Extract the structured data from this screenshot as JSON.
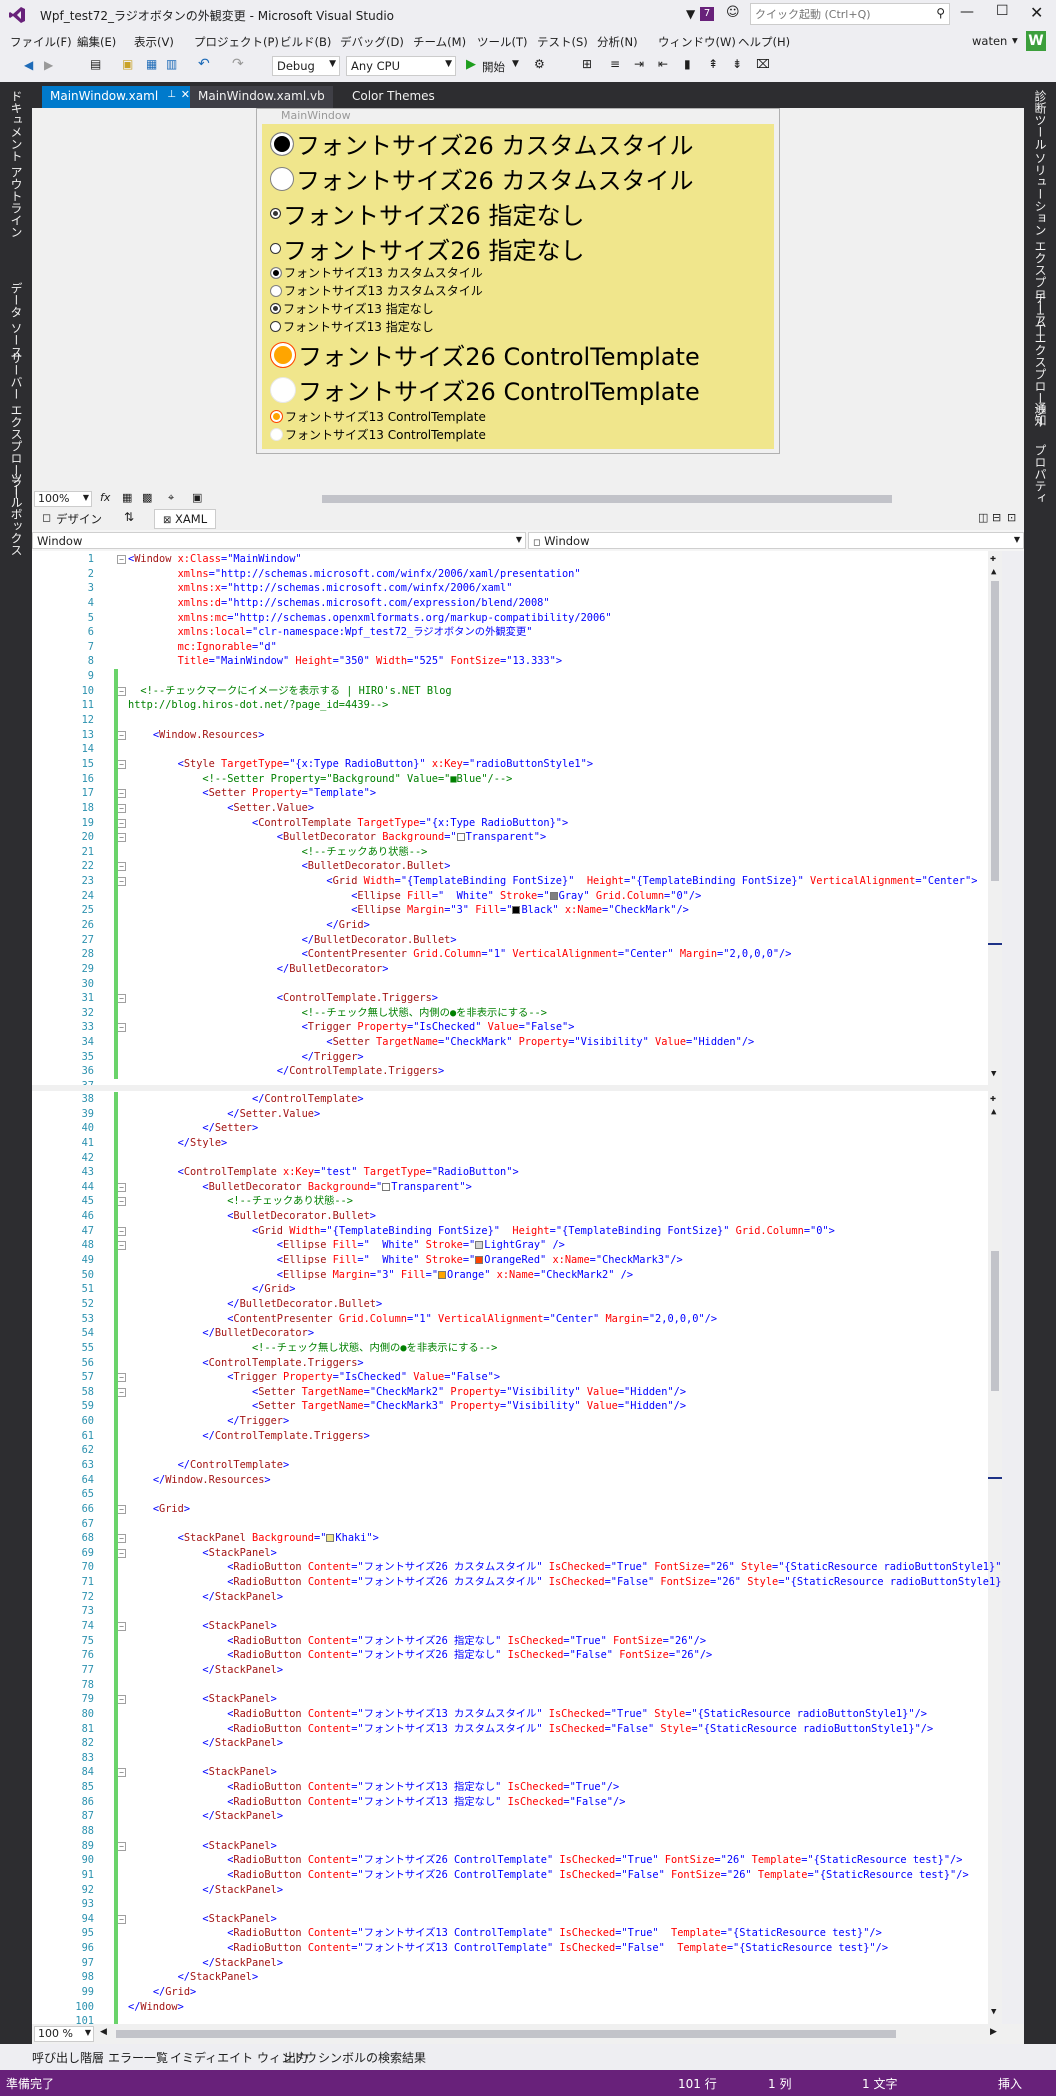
{
  "titlebar": {
    "title": "Wpf_test72_ラジオボタンの外観変更 - Microsoft Visual Studio",
    "notify_count": "7",
    "quick_launch_placeholder": "クイック起動 (Ctrl+Q)"
  },
  "menubar": {
    "items": [
      "ファイル(F)",
      "編集(E)",
      "表示(V)",
      "プロジェクト(P)",
      "ビルド(B)",
      "デバッグ(D)",
      "チーム(M)",
      "ツール(T)",
      "テスト(S)",
      "分析(N)",
      "ウィンドウ(W)",
      "ヘルプ(H)"
    ],
    "user": "waten",
    "user_initial": "W"
  },
  "toolbar": {
    "config": "Debug",
    "platform": "Any CPU",
    "start": "開始"
  },
  "left_panels": [
    "ドキュメント アウトライン",
    "データ ソース",
    "サーバー エクスプローラー",
    "ツールボックス"
  ],
  "right_panels": [
    "診断ツール",
    "ソリューション エクスプローラー",
    "チーム エクスプローラー",
    "通知",
    "プロパティ"
  ],
  "doc_tabs": [
    "MainWindow.xaml",
    "MainWindow.xaml.vb",
    "Color Themes"
  ],
  "designer": {
    "window_title": "MainWindow",
    "zoom": "100%",
    "view_tabs": [
      "デザイン",
      "XAML"
    ],
    "radios": [
      {
        "label": "フォントサイズ26 カスタムスタイル",
        "checked": true
      },
      {
        "label": "フォントサイズ26 カスタムスタイル",
        "checked": false
      },
      {
        "label": "フォントサイズ26 指定なし",
        "checked": true
      },
      {
        "label": "フォントサイズ26 指定なし",
        "checked": false
      },
      {
        "label": "フォントサイズ13 カスタムスタイル",
        "checked": true
      },
      {
        "label": "フォントサイズ13 カスタムスタイル",
        "checked": false
      },
      {
        "label": "フォントサイズ13 指定なし",
        "checked": true
      },
      {
        "label": "フォントサイズ13 指定なし",
        "checked": false
      },
      {
        "label": "フォントサイズ26 ControlTemplate",
        "checked": true
      },
      {
        "label": "フォントサイズ26 ControlTemplate",
        "checked": false
      },
      {
        "label": "フォントサイズ13 ControlTemplate",
        "checked": true
      },
      {
        "label": "フォントサイズ13 ControlTemplate",
        "checked": false
      }
    ]
  },
  "nav": {
    "left": "Window",
    "right": "Window"
  },
  "editor_zoom": "100 %",
  "code": [
    "<Window x:Class=\"MainWindow\"",
    "        xmlns=\"http://schemas.microsoft.com/winfx/2006/xaml/presentation\"",
    "        xmlns:x=\"http://schemas.microsoft.com/winfx/2006/xaml\"",
    "        xmlns:d=\"http://schemas.microsoft.com/expression/blend/2008\"",
    "        xmlns:mc=\"http://schemas.openxmlformats.org/markup-compatibility/2006\"",
    "        xmlns:local=\"clr-namespace:Wpf_test72_ラジオボタンの外観変更\"",
    "        mc:Ignorable=\"d\"",
    "        Title=\"MainWindow\" Height=\"350\" Width=\"525\" FontSize=\"13.333\">",
    "",
    "  <!--チェックマークにイメージを表示する | HIRO's.NET Blog",
    "http://blog.hiros-dot.net/?page_id=4439-->",
    "",
    "    <Window.Resources>",
    "",
    "        <Style TargetType=\"{x:Type RadioButton}\" x:Key=\"radioButtonStyle1\">",
    "            <!--Setter Property=\"Background\" Value=\"■Blue\"/-->",
    "            <Setter Property=\"Template\">",
    "                <Setter.Value>",
    "                    <ControlTemplate TargetType=\"{x:Type RadioButton}\">",
    "                        <BulletDecorator Background=\"□Transparent\">",
    "                            <!--チェックあり状態-->",
    "                            <BulletDecorator.Bullet>",
    "                                <Grid Width=\"{TemplateBinding FontSize}\"  Height=\"{TemplateBinding FontSize}\" VerticalAlignment=\"Center\">",
    "                                    <Ellipse Fill=\"  White\" Stroke=\"■Gray\" Grid.Column=\"0\"/>",
    "                                    <Ellipse Margin=\"3\" Fill=\"■Black\" x:Name=\"CheckMark\"/>",
    "                                </Grid>",
    "                            </BulletDecorator.Bullet>",
    "                            <ContentPresenter Grid.Column=\"1\" VerticalAlignment=\"Center\" Margin=\"2,0,0,0\"/>",
    "                        </BulletDecorator>",
    "",
    "                        <ControlTemplate.Triggers>",
    "                            <!--チェック無し状態、内側の●を非表示にする-->",
    "                            <Trigger Property=\"IsChecked\" Value=\"False\">",
    "                                <Setter TargetName=\"CheckMark\" Property=\"Visibility\" Value=\"Hidden\"/>",
    "                            </Trigger>",
    "                        </ControlTemplate.Triggers>",
    "",
    "                    </ControlTemplate>",
    "                </Setter.Value>",
    "            </Setter>",
    "        </Style>",
    "",
    "        <ControlTemplate x:Key=\"test\" TargetType=\"RadioButton\">",
    "            <BulletDecorator Background=\"□Transparent\">",
    "                <!--チェックあり状態-->",
    "                <BulletDecorator.Bullet>",
    "                    <Grid Width=\"{TemplateBinding FontSize}\"  Height=\"{TemplateBinding FontSize}\" Grid.Column=\"0\">",
    "                        <Ellipse Fill=\"  White\" Stroke=\"□LightGray\" />",
    "                        <Ellipse Fill=\"  White\" Stroke=\"■OrangeRed\" x:Name=\"CheckMark3\"/>",
    "                        <Ellipse Margin=\"3\" Fill=\"■Orange\" x:Name=\"CheckMark2\" />",
    "                    </Grid>",
    "                </BulletDecorator.Bullet>",
    "                <ContentPresenter Grid.Column=\"1\" VerticalAlignment=\"Center\" Margin=\"2,0,0,0\"/>",
    "            </BulletDecorator>",
    "                    <!--チェック無し状態、内側の●を非表示にする-->",
    "            <ControlTemplate.Triggers>",
    "                <Trigger Property=\"IsChecked\" Value=\"False\">",
    "                    <Setter TargetName=\"CheckMark2\" Property=\"Visibility\" Value=\"Hidden\"/>",
    "                    <Setter TargetName=\"CheckMark3\" Property=\"Visibility\" Value=\"Hidden\"/>",
    "                </Trigger>",
    "            </ControlTemplate.Triggers>",
    "",
    "        </ControlTemplate>",
    "    </Window.Resources>",
    "",
    "    <Grid>",
    "",
    "        <StackPanel Background=\"□Khaki\">",
    "            <StackPanel>",
    "                <RadioButton Content=\"フォントサイズ26 カスタムスタイル\" IsChecked=\"True\" FontSize=\"26\" Style=\"{StaticResource radioButtonStyle1}\"/>",
    "                <RadioButton Content=\"フォントサイズ26 カスタムスタイル\" IsChecked=\"False\" FontSize=\"26\" Style=\"{StaticResource radioButtonStyle1}\"/>",
    "            </StackPanel>",
    "",
    "            <StackPanel>",
    "                <RadioButton Content=\"フォントサイズ26 指定なし\" IsChecked=\"True\" FontSize=\"26\"/>",
    "                <RadioButton Content=\"フォントサイズ26 指定なし\" IsChecked=\"False\" FontSize=\"26\"/>",
    "            </StackPanel>",
    "",
    "            <StackPanel>",
    "                <RadioButton Content=\"フォントサイズ13 カスタムスタイル\" IsChecked=\"True\" Style=\"{StaticResource radioButtonStyle1}\"/>",
    "                <RadioButton Content=\"フォントサイズ13 カスタムスタイル\" IsChecked=\"False\" Style=\"{StaticResource radioButtonStyle1}\"/>",
    "            </StackPanel>",
    "",
    "            <StackPanel>",
    "                <RadioButton Content=\"フォントサイズ13 指定なし\" IsChecked=\"True\"/>",
    "                <RadioButton Content=\"フォントサイズ13 指定なし\" IsChecked=\"False\"/>",
    "            </StackPanel>",
    "",
    "            <StackPanel>",
    "                <RadioButton Content=\"フォントサイズ26 ControlTemplate\" IsChecked=\"True\" FontSize=\"26\" Template=\"{StaticResource test}\"/>",
    "                <RadioButton Content=\"フォントサイズ26 ControlTemplate\" IsChecked=\"False\" FontSize=\"26\" Template=\"{StaticResource test}\"/>",
    "            </StackPanel>",
    "",
    "            <StackPanel>",
    "                <RadioButton Content=\"フォントサイズ13 ControlTemplate\" IsChecked=\"True\"  Template=\"{StaticResource test}\"/>",
    "                <RadioButton Content=\"フォントサイズ13 ControlTemplate\" IsChecked=\"False\"  Template=\"{StaticResource test}\"/>",
    "            </StackPanel>",
    "        </StackPanel>",
    "    </Grid>",
    "</Window>",
    ""
  ],
  "bottom_tabs": [
    "呼び出し階層",
    "エラー一覧",
    "イミディエイト ウィンドウ",
    "出力",
    "シンボルの検索結果"
  ],
  "status": {
    "ready": "準備完了",
    "line": "101 行",
    "col": "1 列",
    "ch": "1 文字",
    "mode": "挿入"
  },
  "colors": {
    "accent": "#68217a",
    "khaki": "#f0e68c",
    "orange": "#ffa500",
    "orangered": "#ff4500"
  }
}
